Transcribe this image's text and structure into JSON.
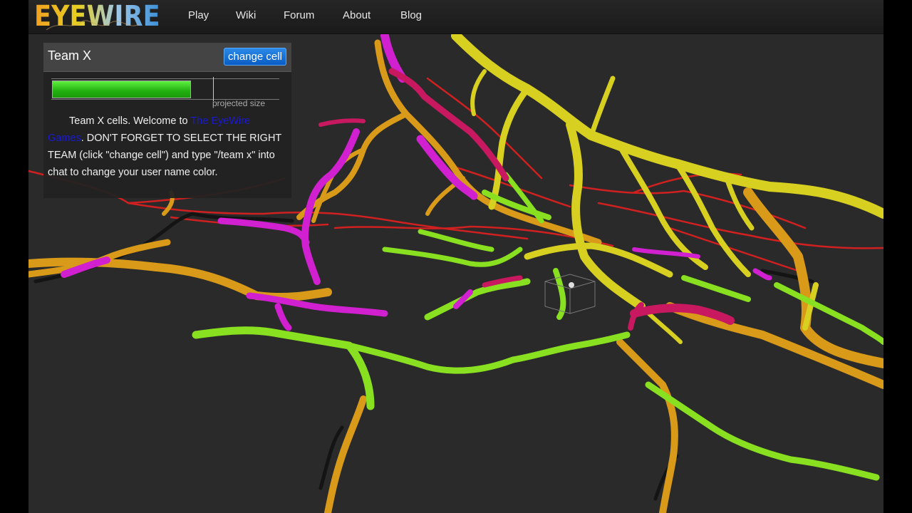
{
  "brand": {
    "logo_text": "EYEWIRE"
  },
  "nav": {
    "items": [
      {
        "label": "Play"
      },
      {
        "label": "Wiki"
      },
      {
        "label": "Forum"
      },
      {
        "label": "About"
      },
      {
        "label": "Blog"
      }
    ]
  },
  "panel": {
    "title": "Team X",
    "change_button": "change cell",
    "progress_fraction": 0.61,
    "projected_fraction": 0.71,
    "projected_label": "projected size",
    "message": {
      "part1": "Team X cells. Welcome to ",
      "link": "The EyeWire Games",
      "part2": ". DON'T FORGET TO SELECT THE RIGHT TEAM (click \"change cell\") and type \"/team x\" into chat to change your user name color."
    }
  },
  "colors": {
    "background": "#2a2a2a",
    "nav_background": "#1e1e1e",
    "button_blue": "#0a5cc4",
    "progress_green": "#22b010",
    "link_blue": "#1a1ad0",
    "neuron_yellow": "#d8d020",
    "neuron_orange": "#d89a18",
    "neuron_green": "#88e020",
    "neuron_magenta": "#d020d0",
    "neuron_red": "#d02020",
    "neuron_crimson": "#c81860"
  }
}
